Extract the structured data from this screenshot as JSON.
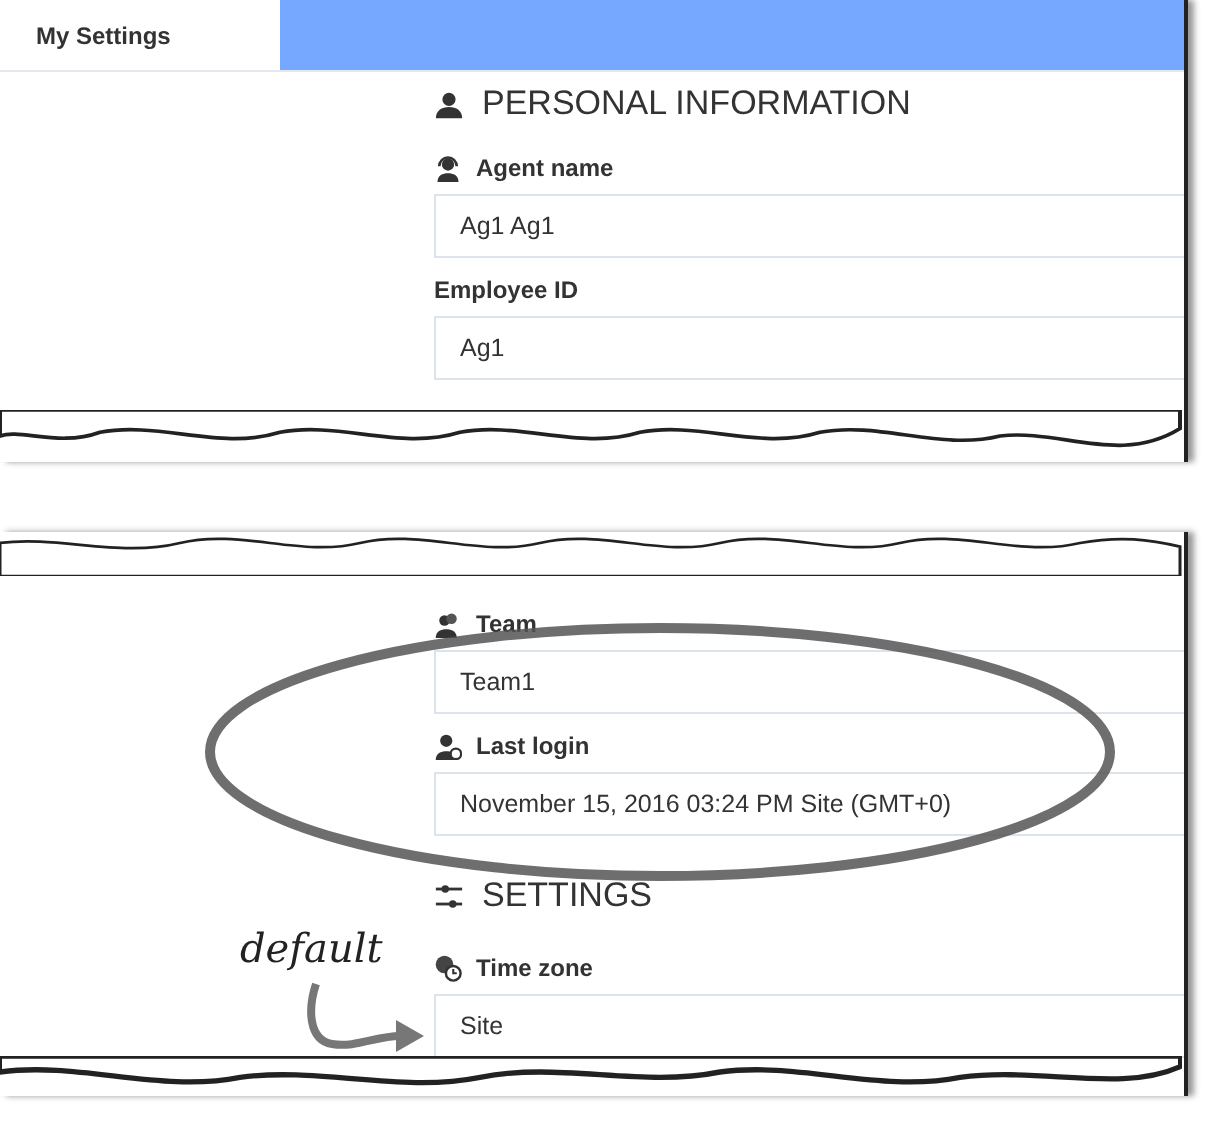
{
  "tab": {
    "label": "My Settings",
    "selected": true
  },
  "personal": {
    "heading": "PERSONAL INFORMATION",
    "fields": [
      {
        "label": "Agent name",
        "kind": "agent",
        "value": "Ag1 Ag1"
      },
      {
        "label": "Employee ID",
        "kind": "plain",
        "value": "Ag1"
      }
    ]
  },
  "details": {
    "fields": [
      {
        "label": "Team",
        "kind": "team",
        "value": "Team1"
      },
      {
        "label": "Last login",
        "kind": "login",
        "value": "November 15, 2016 03:24 PM Site (GMT+0)"
      }
    ]
  },
  "settings": {
    "heading": "SETTINGS",
    "fields": [
      {
        "label": "Time zone",
        "kind": "timezone",
        "value": "Site"
      }
    ]
  },
  "annotation": {
    "text": "default"
  }
}
